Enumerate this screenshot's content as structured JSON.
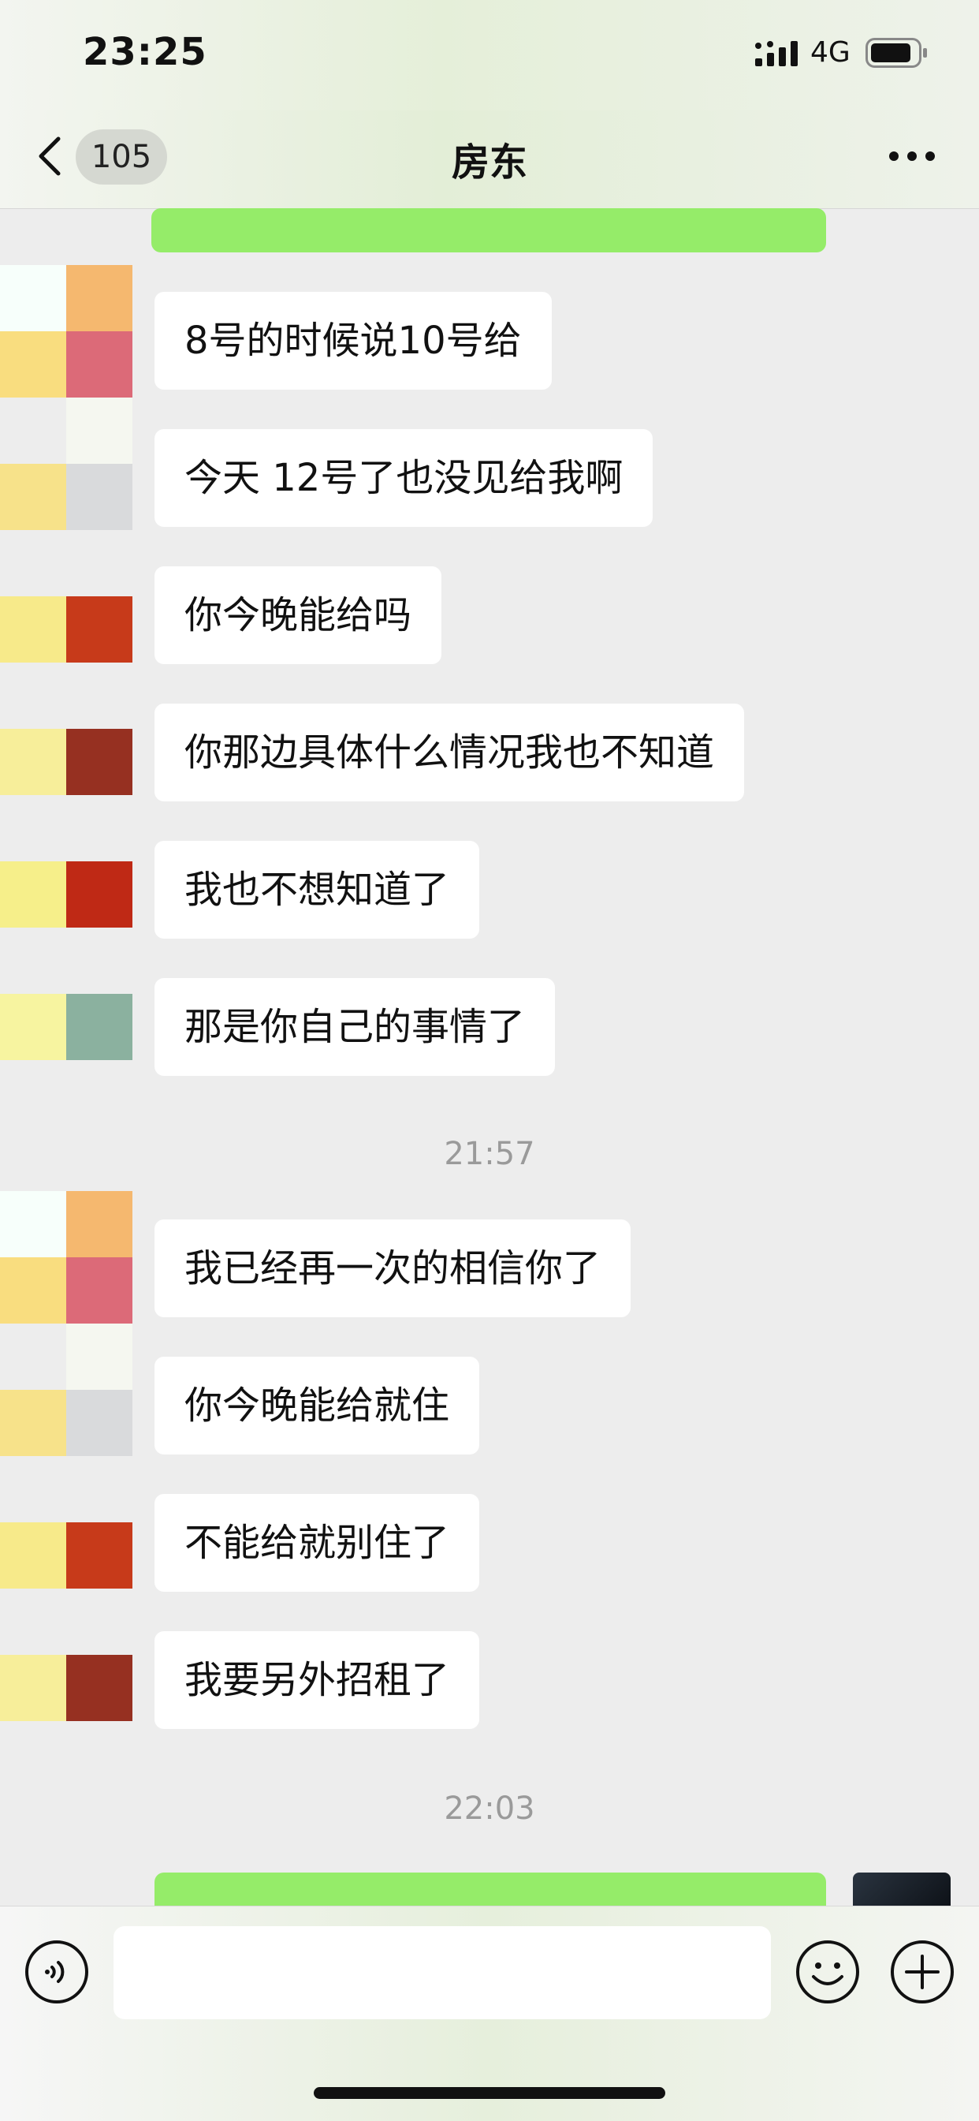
{
  "status_bar": {
    "time": "23:25",
    "network": "4G"
  },
  "nav": {
    "unread_count": "105",
    "title": "房东"
  },
  "messages": [
    {
      "text": "8号的时候说10号给"
    },
    {
      "text": "今天 12号了也没见给我啊"
    },
    {
      "text": "你今晚能给吗"
    },
    {
      "text": "你那边具体什么情况我也不知道"
    },
    {
      "text": "我也不想知道了"
    },
    {
      "text": "那是你自己的事情了"
    },
    {
      "text": "我已经再一次的相信你了"
    },
    {
      "text": "你今晚能给就住"
    },
    {
      "text": "不能给就别住了"
    },
    {
      "text": "我要另外招租了"
    }
  ],
  "timestamps": [
    "21:57",
    "22:03"
  ],
  "input": {
    "placeholder": ""
  },
  "colors": {
    "sent_bubble": "#95ec69",
    "received_bubble": "#ffffff",
    "chat_background": "#ededed"
  }
}
